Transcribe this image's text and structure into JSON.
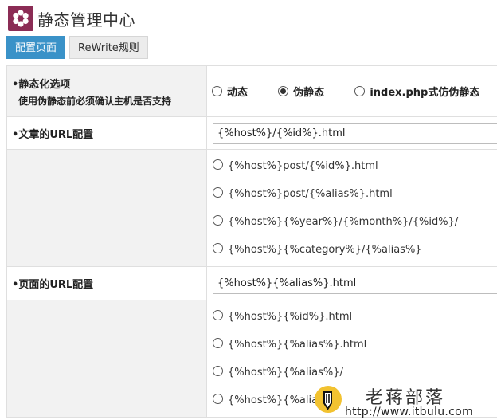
{
  "header": {
    "title": "静态管理中心",
    "logo_icon": "flower-logo-icon"
  },
  "tabs": [
    {
      "label": "配置页面",
      "active": true
    },
    {
      "label": "ReWrite规则",
      "active": false
    }
  ],
  "rows": {
    "static_mode": {
      "label": "静态化选项",
      "sublabel": "使用伪静态前必须确认主机是否支持",
      "options": [
        "动态",
        "伪静态",
        "index.php式仿伪静态"
      ],
      "selected": "伪静态"
    },
    "article_url": {
      "label": "文章的URL配置",
      "value": "{%host%}/{%id%}.html",
      "options": [
        "{%host%}post/{%id%}.html",
        "{%host%}post/{%alias%}.html",
        "{%host%}{%year%}/{%month%}/{%id%}/",
        "{%host%}{%category%}/{%alias%}"
      ]
    },
    "page_url": {
      "label": "页面的URL配置",
      "value": "{%host%}{%alias%}.html",
      "options": [
        "{%host%}{%id%}.html",
        "{%host%}{%alias%}.html",
        "{%host%}{%alias%}/",
        "{%host%}{%alias%}"
      ]
    }
  },
  "watermark": {
    "title": "老蒋部落",
    "url": "http://www.itbulu.com"
  },
  "colors": {
    "accent": "#3a92c8",
    "logo_bg": "#8b2c55",
    "label_bg": "#f2f2f2",
    "watermark_yellow": "#f2c230"
  }
}
